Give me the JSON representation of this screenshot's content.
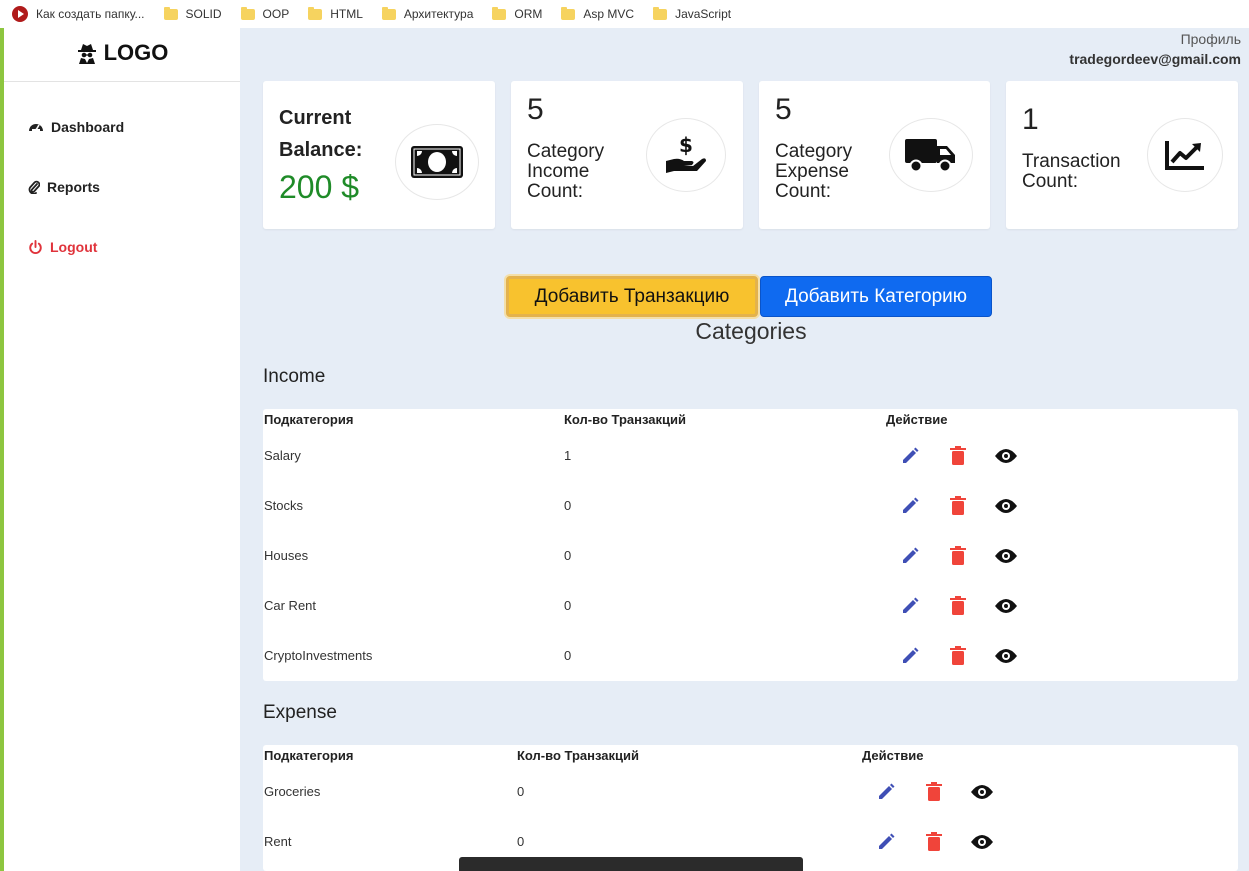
{
  "bookmarks": [
    {
      "label": "Как создать папку...",
      "icon": "youtube-icon"
    },
    {
      "label": "SOLID",
      "icon": "folder-icon"
    },
    {
      "label": "OOP",
      "icon": "folder-icon"
    },
    {
      "label": "HTML",
      "icon": "folder-icon"
    },
    {
      "label": "Архитектура",
      "icon": "folder-icon"
    },
    {
      "label": "ORM",
      "icon": "folder-icon"
    },
    {
      "label": "Asp MVC",
      "icon": "folder-icon"
    },
    {
      "label": "JavaScript",
      "icon": "folder-icon"
    }
  ],
  "sidebar": {
    "logo": "LOGO",
    "items": [
      {
        "label": "Dashboard",
        "icon": "gauge-icon"
      },
      {
        "label": "Reports",
        "icon": "paperclip-icon"
      },
      {
        "label": "Logout",
        "icon": "power-icon"
      }
    ]
  },
  "header": {
    "profile_label": "Профиль",
    "email": "tradegordeev@gmail.com"
  },
  "stats": {
    "balance": {
      "label": "Current Balance:",
      "value": "200 $",
      "icon": "money-bill-icon"
    },
    "income": {
      "count": "5",
      "label": "Category Income Count:",
      "icon": "hand-dollar-icon"
    },
    "expense": {
      "count": "5",
      "label": "Category Expense Count:",
      "icon": "truck-icon"
    },
    "transactions": {
      "count": "1",
      "label": "Transaction Count:",
      "icon": "trend-chart-icon"
    }
  },
  "actions": {
    "add_transaction": "Добавить Транзакцию",
    "add_category": "Добавить Категорию"
  },
  "categories_title": "Categories",
  "income": {
    "title": "Income",
    "columns": [
      "Подкатегория",
      "Кол-во Транзакций",
      "Действие"
    ],
    "rows": [
      {
        "name": "Salary",
        "count": "1"
      },
      {
        "name": "Stocks",
        "count": "0"
      },
      {
        "name": "Houses",
        "count": "0"
      },
      {
        "name": "Car Rent",
        "count": "0"
      },
      {
        "name": "CryptoInvestments",
        "count": "0"
      }
    ]
  },
  "expense": {
    "title": "Expense",
    "columns": [
      "Подкатегория",
      "Кол-во Транзакций",
      "Действие"
    ],
    "rows": [
      {
        "name": "Groceries",
        "count": "0"
      },
      {
        "name": "Rent",
        "count": "0"
      }
    ]
  },
  "colors": {
    "accent": "#8dc63f",
    "balance": "#1f8b28",
    "edit": "#3f4fb5",
    "delete": "#f0443a",
    "logout": "#e0333b",
    "primary_button": "#0f6af0",
    "warning_button": "#f8c22e"
  }
}
